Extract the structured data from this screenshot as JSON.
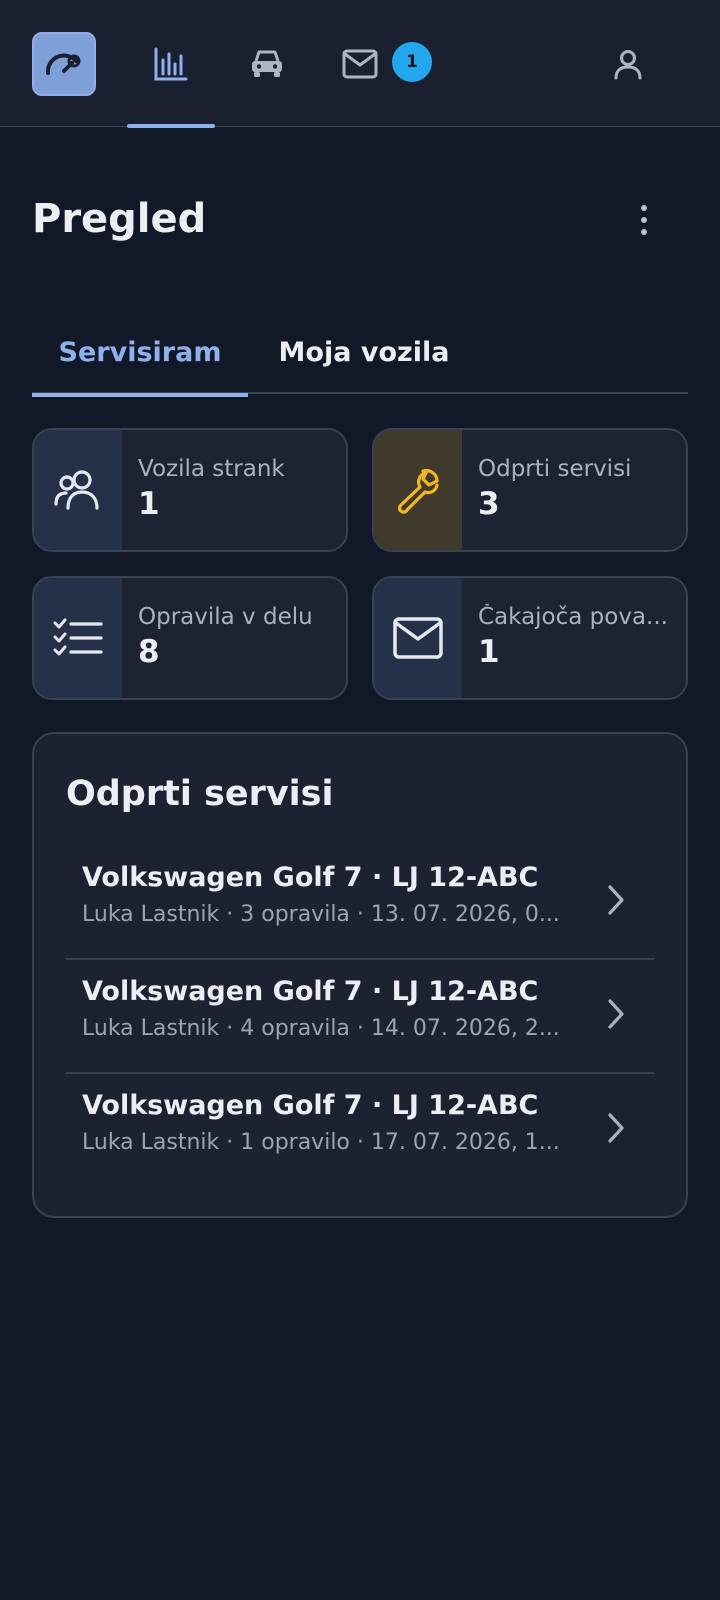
{
  "nav": {
    "items": [
      {
        "name": "logo",
        "icon": "gauge-wrench-icon"
      },
      {
        "name": "stats",
        "icon": "bar-chart-icon",
        "active": true
      },
      {
        "name": "vehicles",
        "icon": "car-icon"
      },
      {
        "name": "messages",
        "icon": "mail-icon"
      },
      {
        "name": "profile",
        "icon": "user-icon"
      }
    ],
    "messages_badge": "1"
  },
  "page": {
    "title": "Pregled"
  },
  "tabs": [
    {
      "label": "Servisiram",
      "active": true
    },
    {
      "label": "Moja vozila",
      "active": false
    }
  ],
  "stats": [
    {
      "label": "Vozila strank",
      "value": "1",
      "icon": "users-icon",
      "icon_bg": "#253149",
      "icon_color": "#e6e9ef"
    },
    {
      "label": "Odprti servisi",
      "value": "3",
      "icon": "wrench-icon",
      "icon_bg": "#3f3a2b",
      "icon_color": "#f3b724"
    },
    {
      "label": "Opravila v delu",
      "value": "8",
      "icon": "checklist-icon",
      "icon_bg": "#253149",
      "icon_color": "#e6e9ef"
    },
    {
      "label": "Čakajoča pova...",
      "value": "1",
      "icon": "mail-icon",
      "icon_bg": "#253149",
      "icon_color": "#e6e9ef"
    }
  ],
  "open_services": {
    "title": "Odprti servisi",
    "rows": [
      {
        "title": "Volkswagen Golf 7 · LJ 12-ABC",
        "subtitle": "Luka Lastnik · 3 opravila · 13. 07. 2026, 0..."
      },
      {
        "title": "Volkswagen Golf 7 · LJ 12-ABC",
        "subtitle": "Luka Lastnik · 4 opravila · 14. 07. 2026, 2..."
      },
      {
        "title": "Volkswagen Golf 7 · LJ 12-ABC",
        "subtitle": "Luka Lastnik · 1 opravilo · 17. 07. 2026, 1..."
      }
    ]
  },
  "colors": {
    "background": "#111827",
    "accent": "#8fb0ea",
    "badge": "#22a7ee",
    "warning": "#f3b724"
  }
}
